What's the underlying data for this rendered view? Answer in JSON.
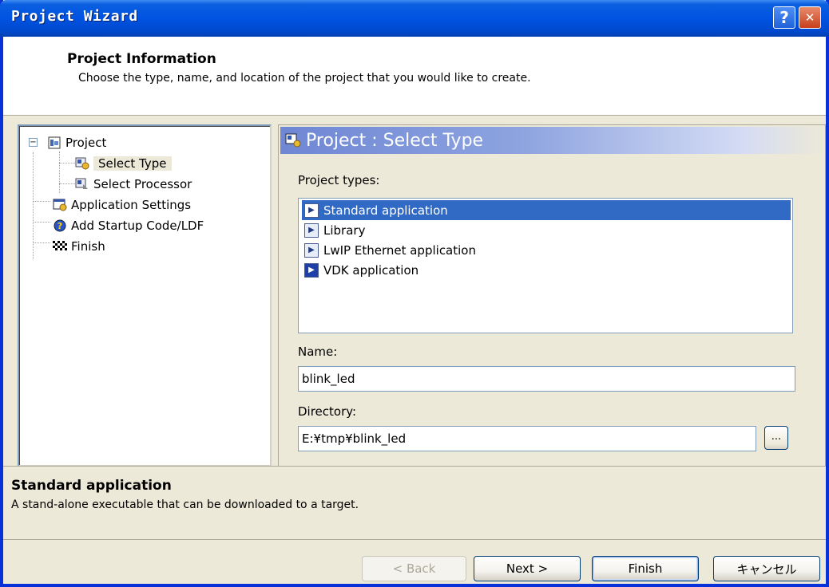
{
  "window": {
    "title": "Project Wizard",
    "help_glyph": "?",
    "close_glyph": "✕"
  },
  "header": {
    "title": "Project Information",
    "subtitle": "Choose the type, name, and location of the project that you would like to create."
  },
  "tree": {
    "expander_glyph": "−",
    "items": [
      {
        "label": "Project",
        "icon": "project-icon"
      },
      {
        "label": "Select Type",
        "icon": "select-type-icon",
        "selected": true
      },
      {
        "label": "Select Processor",
        "icon": "select-processor-icon"
      },
      {
        "label": "Application Settings",
        "icon": "application-settings-icon"
      },
      {
        "label": "Add Startup Code/LDF",
        "icon": "help-question-icon"
      },
      {
        "label": "Finish",
        "icon": "checkered-flag-icon"
      }
    ]
  },
  "panel": {
    "title": "Project : Select Type",
    "project_types_label": "Project types:",
    "project_types": [
      {
        "label": "Standard application",
        "icon": "application-icon",
        "selected": true
      },
      {
        "label": "Library",
        "icon": "application-icon"
      },
      {
        "label": "LwIP Ethernet application",
        "icon": "application-icon"
      },
      {
        "label": "VDK application",
        "icon": "vdk-icon"
      }
    ],
    "name_label": "Name:",
    "name_value": "blink_led",
    "directory_label": "Directory:",
    "directory_value": "E:¥tmp¥blink_led",
    "browse_label": "..."
  },
  "description": {
    "title": "Standard application",
    "text": "A stand-alone executable that can be downloaded to a target."
  },
  "buttons": {
    "back": "< Back",
    "next": "Next >",
    "finish": "Finish",
    "cancel": "キャンセル"
  },
  "colors": {
    "titlebar": "#0053E1",
    "selection": "#316AC5",
    "dialog_bg": "#ECE9D8"
  }
}
